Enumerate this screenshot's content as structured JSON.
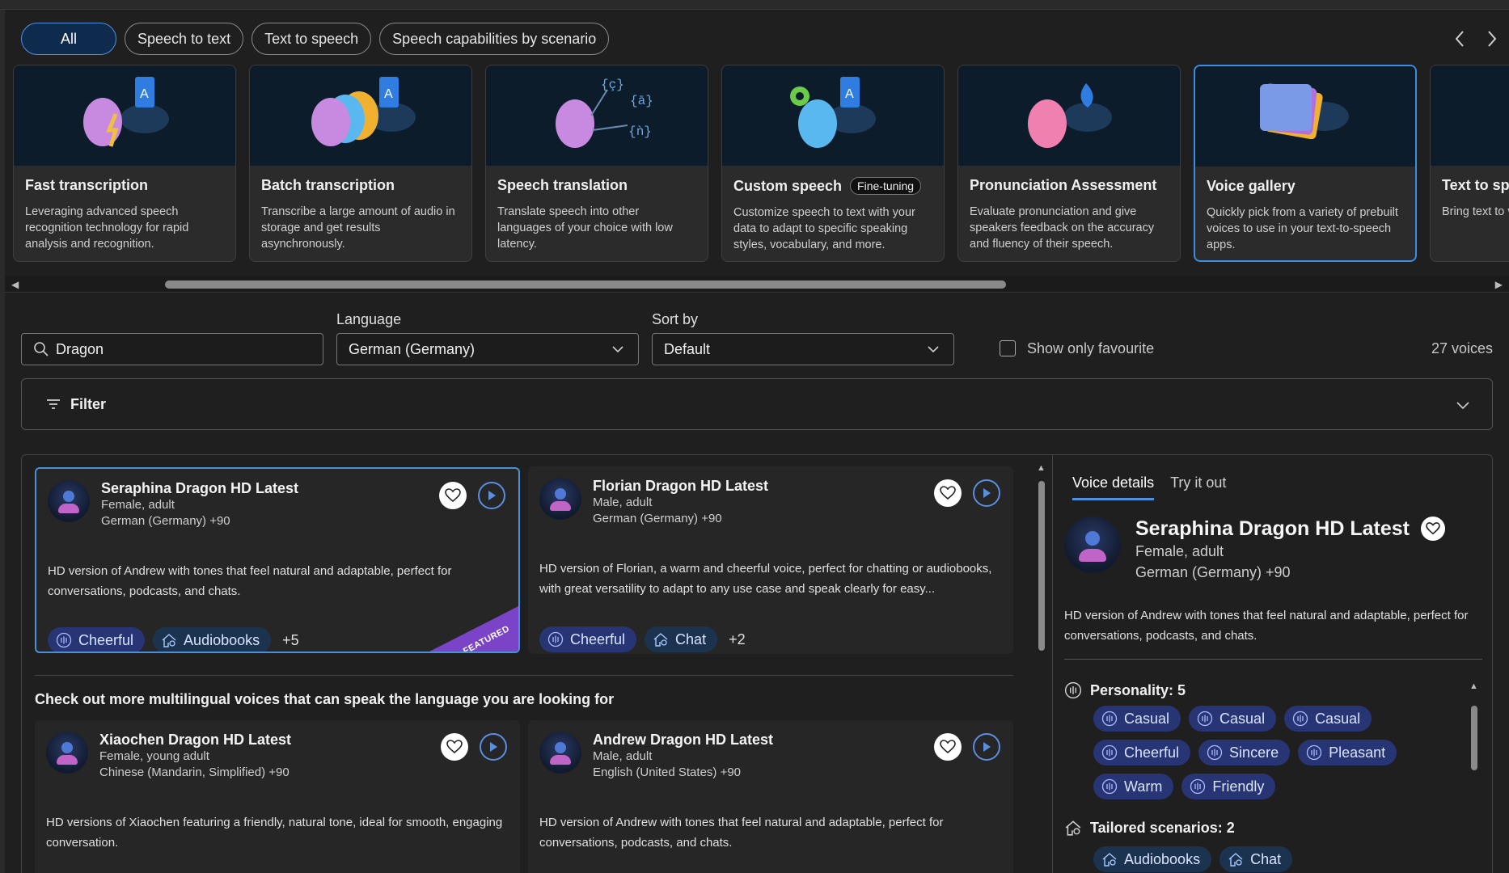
{
  "tabs": [
    {
      "label": "All",
      "active": true
    },
    {
      "label": "Speech to text",
      "active": false
    },
    {
      "label": "Text to speech",
      "active": false
    },
    {
      "label": "Speech capabilities by scenario",
      "active": false
    }
  ],
  "scenarios": [
    {
      "title": "Fast transcription",
      "badge": "",
      "desc": "Leveraging advanced speech recognition technology for rapid analysis and recognition."
    },
    {
      "title": "Batch transcription",
      "badge": "",
      "desc": "Transcribe a large amount of audio in storage and get results asynchronously."
    },
    {
      "title": "Speech translation",
      "badge": "",
      "desc": "Translate speech into other languages of your choice with low latency."
    },
    {
      "title": "Custom speech",
      "badge": "Fine-tuning",
      "desc": "Customize speech to text with your data to adapt to specific speaking styles, vocabulary, and more."
    },
    {
      "title": "Pronunciation Assessment",
      "badge": "",
      "desc": "Evaluate pronunciation and give speakers feedback on the accuracy and fluency of their speech."
    },
    {
      "title": "Voice gallery",
      "badge": "",
      "desc": "Quickly pick from a variety of prebuilt voices to use in your text-to-speech apps."
    },
    {
      "title": "Text to spe",
      "badge": "",
      "desc": "Bring text to voices and p avatars."
    }
  ],
  "search": {
    "value": "Dragon"
  },
  "language": {
    "label": "Language",
    "value": "German (Germany)"
  },
  "sort": {
    "label": "Sort by",
    "value": "Default"
  },
  "favourite_label": "Show only favourite",
  "voice_count": "27 voices",
  "filter_label": "Filter",
  "section_title": "Check out more multilingual voices that can speak the language you are looking for",
  "voices": [
    {
      "name": "Seraphina Dragon HD Latest",
      "gender": "Female, adult",
      "locale": "German (Germany) +90",
      "desc": "HD version of Andrew with tones that feel natural and adaptable, perfect for conversations, podcasts, and chats.",
      "tag1": "Cheerful",
      "tag2": "Audiobooks",
      "more": "+5",
      "featured": "FEATURED"
    },
    {
      "name": "Florian Dragon HD Latest",
      "gender": "Male, adult",
      "locale": "German (Germany) +90",
      "desc": "HD version of Florian, a warm and cheerful voice, perfect for chatting or audiobooks, with great versatility to adapt to any use case and speak clearly for easy...",
      "tag1": "Cheerful",
      "tag2": "Chat",
      "more": "+2"
    },
    {
      "name": "Xiaochen Dragon HD Latest",
      "gender": "Female, young adult",
      "locale": "Chinese (Mandarin, Simplified) +90",
      "desc": "HD versions of Xiaochen featuring a friendly, natural tone, ideal for smooth, engaging conversation."
    },
    {
      "name": "Andrew Dragon HD Latest",
      "gender": "Male, adult",
      "locale": "English (United States) +90",
      "desc": "HD version of Andrew with tones that feel natural and adaptable, perfect for conversations, podcasts, and chats."
    }
  ],
  "details": {
    "tab1": "Voice details",
    "tab2": "Try it out",
    "name": "Seraphina Dragon HD Latest",
    "gender": "Female, adult",
    "locale": "German (Germany) +90",
    "desc": "HD version of Andrew with tones that feel natural and adaptable, perfect for conversations, podcasts, and chats.",
    "personality_title": "Personality: 5",
    "personality": [
      "Casual",
      "Casual",
      "Casual",
      "Cheerful",
      "Sincere",
      "Pleasant",
      "Warm",
      "Friendly"
    ],
    "scenarios_title": "Tailored scenarios: 2",
    "scenarios": [
      "Audiobooks",
      "Chat"
    ]
  },
  "colors": {
    "accent": "#4f90e0",
    "card_bg": "#2b2b2b",
    "art_bg": "#0d1c2a",
    "pill_purple": "#283575",
    "featured": "#7a43c8"
  }
}
